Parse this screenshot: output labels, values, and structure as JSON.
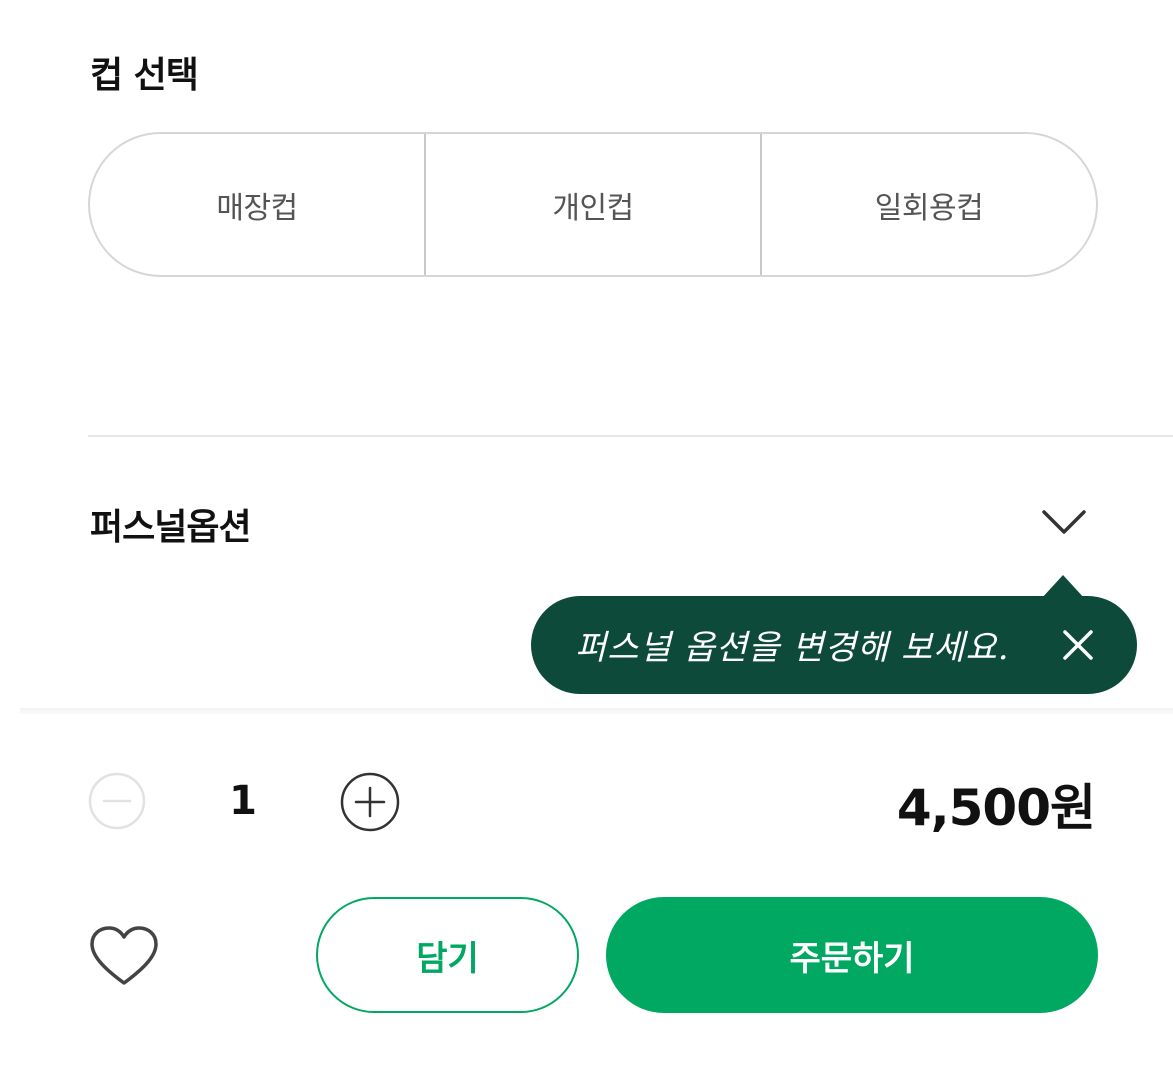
{
  "cup_selection": {
    "title": "컵 선택",
    "options": [
      "매장컵",
      "개인컵",
      "일회용컵"
    ]
  },
  "personal_option": {
    "title": "퍼스널옵션",
    "tooltip": "퍼스널 옵션을 변경해 보세요."
  },
  "quantity": {
    "value": "1"
  },
  "price": "4,500원",
  "actions": {
    "cart_label": "담기",
    "order_label": "주문하기"
  },
  "colors": {
    "accent": "#00a862",
    "tooltip_bg": "#0d4a3a"
  },
  "icons": {
    "expand": "chevron-down-icon",
    "close": "close-icon",
    "minus": "minus-circle-icon",
    "plus": "plus-circle-icon",
    "favorite": "heart-icon"
  }
}
